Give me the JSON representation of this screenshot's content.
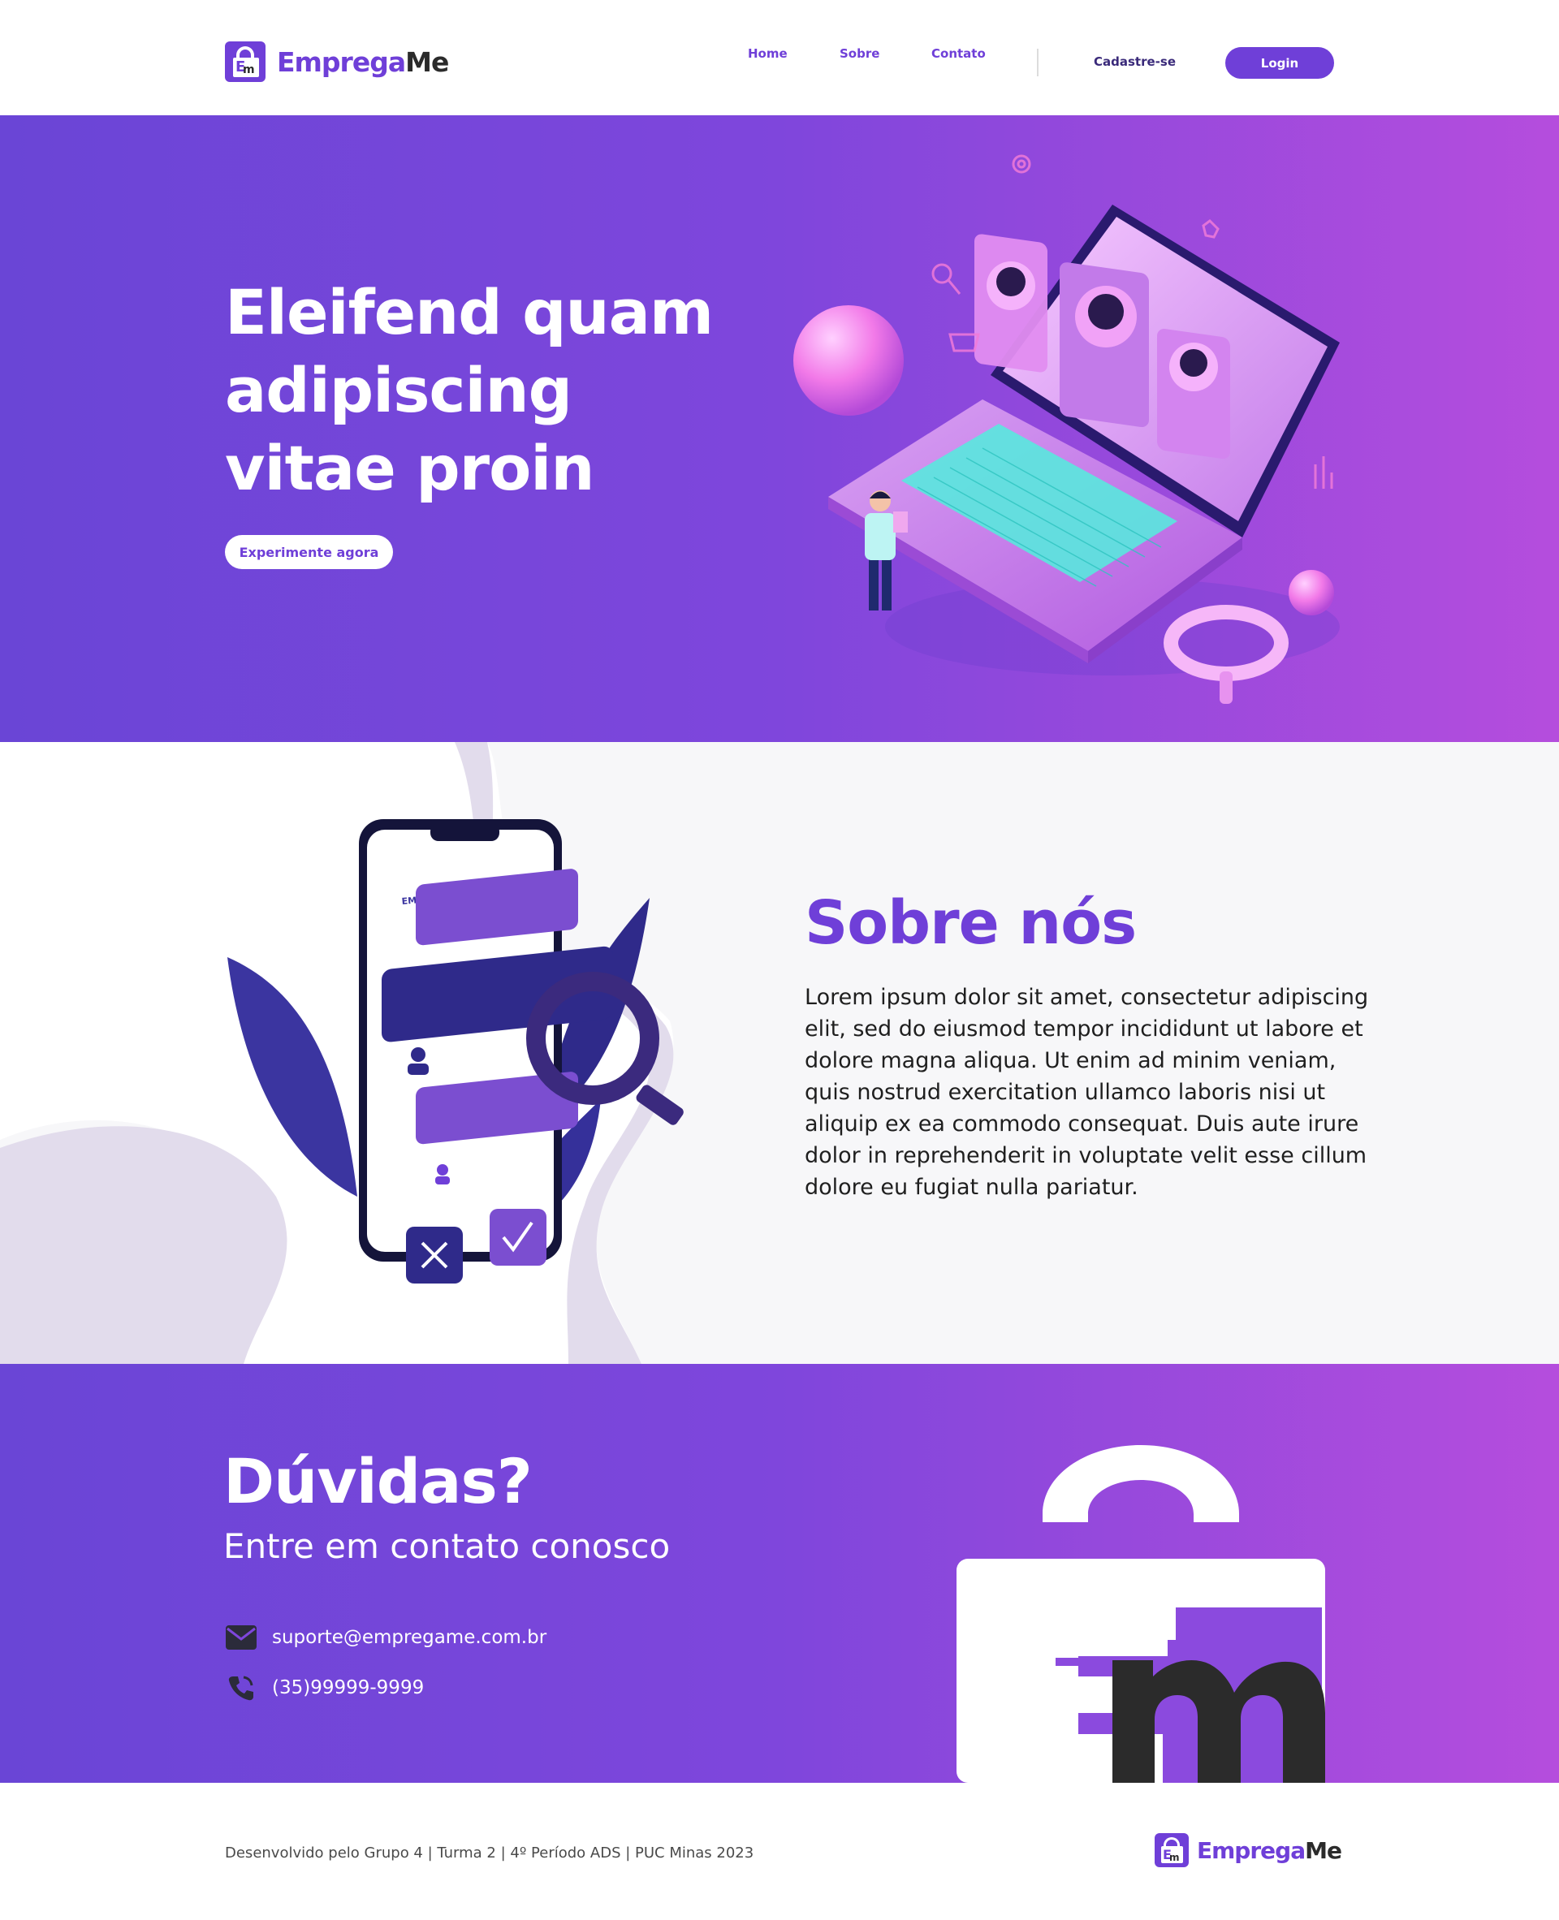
{
  "header": {
    "brand_part1": "Emprega",
    "brand_part2": "Me",
    "nav": {
      "home": "Home",
      "sobre": "Sobre",
      "contato": "Contato"
    },
    "signup_label": "Cadastre-se",
    "login_label": "Login"
  },
  "hero": {
    "title": "Eleifend quam adipiscing vitae proin",
    "cta_label": "Experimente agora"
  },
  "about": {
    "illustration_label": "EMPLOYEES",
    "title": "Sobre nós",
    "text": "Lorem ipsum dolor sit amet, consectetur adipiscing elit, sed do eiusmod tempor incididunt ut labore et dolore magna aliqua. Ut enim ad minim veniam, quis nostrud exercitation ullamco laboris nisi ut aliquip ex ea commodo consequat. Duis aute irure dolor in reprehenderit in voluptate velit esse cillum dolore eu fugiat nulla pariatur."
  },
  "contact": {
    "title": "Dúvidas?",
    "subtitle": "Entre em contato conosco",
    "email": "suporte@empregame.com.br",
    "phone": "(35)99999-9999"
  },
  "footer": {
    "credits": "Desenvolvido pelo Grupo 4 | Turma 2 | 4º Período ADS | PUC Minas 2023",
    "brand_part1": "Emprega",
    "brand_part2": "Me"
  },
  "colors": {
    "brand_purple": "#6f3fd8",
    "brand_dark": "#2b2b2b",
    "gradient_start": "#6a45d6",
    "gradient_end": "#b54ddd"
  },
  "icons": {
    "logo": "briefcase-em-logo-icon",
    "email": "envelope-icon",
    "phone": "phone-icon"
  }
}
